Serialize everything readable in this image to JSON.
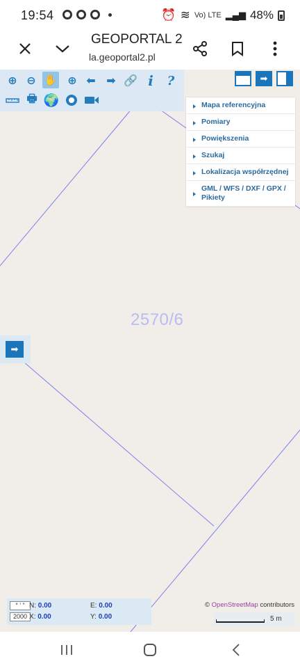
{
  "status_bar": {
    "time": "19:54",
    "signal_label": "Vo) LTE",
    "battery": "48%"
  },
  "browser": {
    "title": "GEOPORTAL 2",
    "url_faded": "",
    "url": "la.geoportal2.pl"
  },
  "map": {
    "parcel_label": "2570/6"
  },
  "side_menu": {
    "items": [
      "Mapa referencyjna",
      "Pomiary",
      "Powiększenia",
      "Szukaj",
      "Lokalizacja współrzędnej",
      "GML / WFS / DXF / GPX / Pikiety"
    ]
  },
  "coords": {
    "format_label": "° ' \"",
    "system_label": "2000",
    "n_label": "N:",
    "n_value": "0.00",
    "e_label": "E:",
    "e_value": "0.00",
    "x_label": "X:",
    "x_value": "0.00",
    "y_label": "Y:",
    "y_value": "0.00"
  },
  "attribution": {
    "prefix": "©",
    "osm": "OpenStreetMap",
    "suffix": "contributors"
  },
  "scale": {
    "label": "5 m"
  },
  "colors": {
    "toolbar_bg": "#dbe9f5",
    "accent": "#1a75bb",
    "map_bg": "#f1eee9",
    "parcel_line": "#7b7ff0"
  }
}
